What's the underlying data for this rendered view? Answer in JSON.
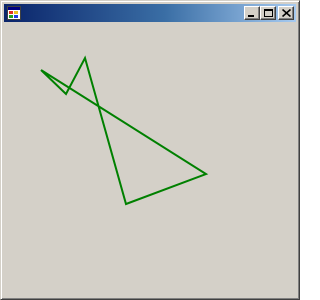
{
  "window": {
    "title": "",
    "icon": "windows-forms-app-icon",
    "controls": [
      "minimize-icon",
      "maximize-icon",
      "close-icon"
    ]
  },
  "canvas": {
    "background": "#d4d0c8",
    "stroke_color": "#008000",
    "shape": "green-polyline"
  },
  "colors": {
    "titlebar_start": "#0a246a",
    "titlebar_end": "#a6caf0",
    "face": "#d4d0c8"
  }
}
